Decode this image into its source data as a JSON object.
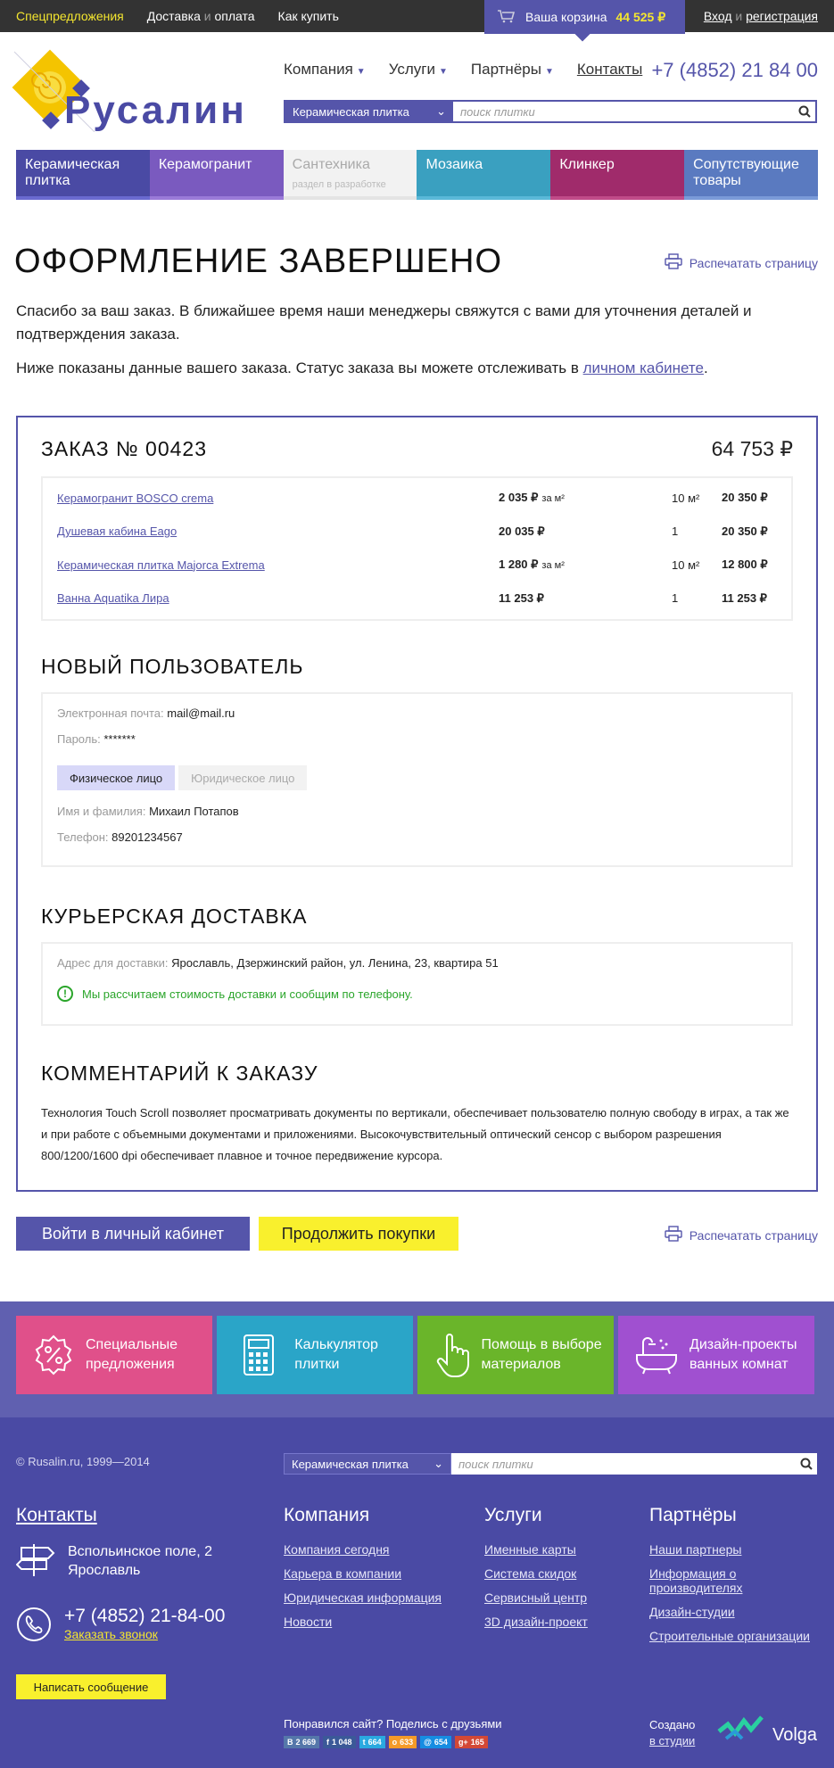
{
  "topbar": {
    "special": "Спецпредложения",
    "delivery_a": "Доставка",
    "delivery_and": "и",
    "delivery_b": "оплата",
    "howto": "Как купить",
    "cart_label": "Ваша корзина",
    "cart_sum": "44 525 ₽",
    "login": "Вход",
    "login_and": "и",
    "register": "регистрация"
  },
  "header": {
    "logo_text": "Русалин",
    "nav": [
      "Компания",
      "Услуги",
      "Партнёры"
    ],
    "contacts": "Контакты",
    "phone": "+7 (4852) 21 84 00",
    "search_category": "Керамическая плитка",
    "search_placeholder": "поиск плитки"
  },
  "categories": [
    {
      "label": "Керамическая плитка",
      "sub": "",
      "color": "#4a4aa4",
      "bar": "#6a6ad0"
    },
    {
      "label": "Керамогранит",
      "sub": "",
      "color": "#7a5abf",
      "bar": "#9a7ad8"
    },
    {
      "label": "Сантехника",
      "sub": "раздел в разработке",
      "color": "#f2f2f2",
      "bar": "#e4e4e4"
    },
    {
      "label": "Мозаика",
      "sub": "",
      "color": "#3aa0c0",
      "bar": "#5ab8d8"
    },
    {
      "label": "Клинкер",
      "sub": "",
      "color": "#a02b6b",
      "bar": "#c04b88"
    },
    {
      "label": "Сопутствующие товары",
      "sub": "",
      "color": "#5a7ac0",
      "bar": "#7a9ad8"
    }
  ],
  "page": {
    "title": "ОФОРМЛЕНИЕ ЗАВЕРШЕНО",
    "print": "Распечатать страницу",
    "intro1": "Спасибо за ваш заказ. В ближайшее время наши менеджеры свяжутся с вами для уточнения деталей и подтверждения заказа.",
    "intro2_a": "Ниже показаны данные вашего заказа. Статус заказа вы можете отслеживать в",
    "intro2_link": "личном кабинете",
    "intro2_b": "."
  },
  "order": {
    "title": "ЗАКАЗ № 00423",
    "total": "64 753 ₽",
    "items": [
      {
        "name": "Керамогранит BOSCO crema",
        "price": "2 035 ₽",
        "per": "за м²",
        "qty": "10 м²",
        "total": "20 350 ₽"
      },
      {
        "name": "Душевая кабина Eago",
        "price": "20 035 ₽",
        "per": "",
        "qty": "1",
        "total": "20 350 ₽"
      },
      {
        "name": "Керамическая плитка Majorca Extrema",
        "price": "1 280 ₽",
        "per": "за м²",
        "qty": "10 м²",
        "total": "12 800 ₽"
      },
      {
        "name": "Ванна Aquatika Лира",
        "price": "11 253 ₽",
        "per": "",
        "qty": "1",
        "total": "11 253 ₽"
      }
    ]
  },
  "user": {
    "title": "НОВЫЙ ПОЛЬЗОВАТЕЛЬ",
    "email_label": "Электронная почта:",
    "email": "mail@mail.ru",
    "password_label": "Пароль:",
    "password": "*******",
    "tab_person": "Физическое лицо",
    "tab_company": "Юридическое лицо",
    "name_label": "Имя и фамилия:",
    "name": "Михаил Потапов",
    "phone_label": "Телефон:",
    "phone": "89201234567"
  },
  "delivery": {
    "title": "КУРЬЕРСКАЯ ДОСТАВКА",
    "address_label": "Адрес для доставки:",
    "address": "Ярославль, Дзержинский район, ул. Ленина, 23, квартира 51",
    "note": "Мы рассчитаем стоимость доставки и сообщим по телефону."
  },
  "comment": {
    "title": "КОММЕНТАРИЙ К ЗАКАЗУ",
    "text": "Технология Touch Scroll позволяет просматривать документы по вертикали, обеспечивает пользователю полную свободу в играх, а так же и при работе с объемными документами и приложениями. Высокочувствительный оптический сенсор с выбором разрешения 800/1200/1600 dpi обеспечивает плавное и точное передвижение курсора."
  },
  "actions": {
    "cabinet": "Войти в личный кабинет",
    "continue": "Продолжить покупки"
  },
  "promo": [
    {
      "label": "Специальные предложения",
      "icon": "percent-icon",
      "color": "#e0508a"
    },
    {
      "label": "Калькулятор плитки",
      "icon": "calculator-icon",
      "color": "#2aa5c8"
    },
    {
      "label": "Помощь в выборе материалов",
      "icon": "hand-pointer-icon",
      "color": "#6ab52a"
    },
    {
      "label": "Дизайн-проекты ванных комнат",
      "icon": "bathtub-icon",
      "color": "#a050d0"
    }
  ],
  "footer": {
    "copyright": "© Rusalin.ru, 1999—2014",
    "search_category": "Керамическая плитка",
    "search_placeholder": "поиск плитки",
    "contacts_title": "Контакты",
    "address": "Вспольинское поле, 2 Ярославль",
    "phone": "+7 (4852) 21-84-00",
    "callback": "Заказать звонок",
    "write": "Написать сообщение",
    "cols": [
      {
        "title": "Компания",
        "links": [
          "Компания сегодня",
          "Карьера в компании",
          "Юридическая информация",
          "Новости"
        ]
      },
      {
        "title": "Услуги",
        "links": [
          "Именные карты",
          "Система скидок",
          "Сервисный центр",
          "3D дизайн-проект"
        ]
      },
      {
        "title": "Партнёры",
        "links": [
          "Наши партнеры",
          "Информация о производителях",
          "Дизайн-студии",
          "Строительные организации"
        ]
      }
    ],
    "share_title": "Понравился сайт? Поделись с друзьями",
    "share": [
      {
        "net": "В",
        "count": "2 669",
        "color": "#5577aa"
      },
      {
        "net": "f",
        "count": "1 048",
        "color": "#3b5998"
      },
      {
        "net": "t",
        "count": "664",
        "color": "#2aa9e0"
      },
      {
        "net": "о",
        "count": "633",
        "color": "#f59a28"
      },
      {
        "net": "@",
        "count": "654",
        "color": "#168de2"
      },
      {
        "net": "g+",
        "count": "165",
        "color": "#d34836"
      }
    ],
    "created": "Создано",
    "studio": "в студии",
    "studio_name": "Volga"
  }
}
